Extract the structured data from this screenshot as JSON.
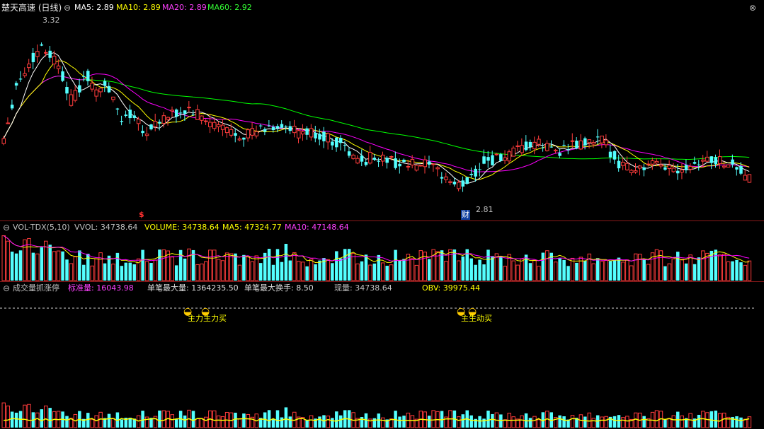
{
  "header": {
    "title": "楚天高速 (日线)",
    "ma5": "MA5: 2.89",
    "ma10": "MA10: 2.89",
    "ma20": "MA20: 2.89",
    "ma60": "MA60: 2.92",
    "high_label": "3.32",
    "low_label": "2.81",
    "marker_dollar": "$",
    "marker_cai": "财"
  },
  "vol_panel": {
    "name": "VOL-TDX(5,10)",
    "vvol": "VVOL: 34738.64",
    "volume": "VOLUME: 34738.64",
    "ma5": "MA5: 47324.77",
    "ma10": "MA10: 47148.64"
  },
  "ind_panel": {
    "name": "成交量抓涨停",
    "std": "标准量: 16043.98",
    "max_single": "单笔最大量: 1364235.50",
    "max_turnover": "单笔最大换手: 8.50",
    "current": "现量: 34738.64",
    "obv": "OBV: 39975.44",
    "signal1": "主力主力买",
    "signal2": "主生动买"
  },
  "colors": {
    "up": "#ff3c3c",
    "down": "#54ffff",
    "ma5": "#ffffff",
    "ma10": "#ffff00",
    "ma20": "#ff00ff",
    "ma60": "#00ff00",
    "separator": "#8b1a1a"
  },
  "chart_data": {
    "type": "candlestick",
    "price_range": [
      2.75,
      3.38
    ],
    "series_names": [
      "MA5",
      "MA10",
      "MA20",
      "MA60"
    ]
  }
}
